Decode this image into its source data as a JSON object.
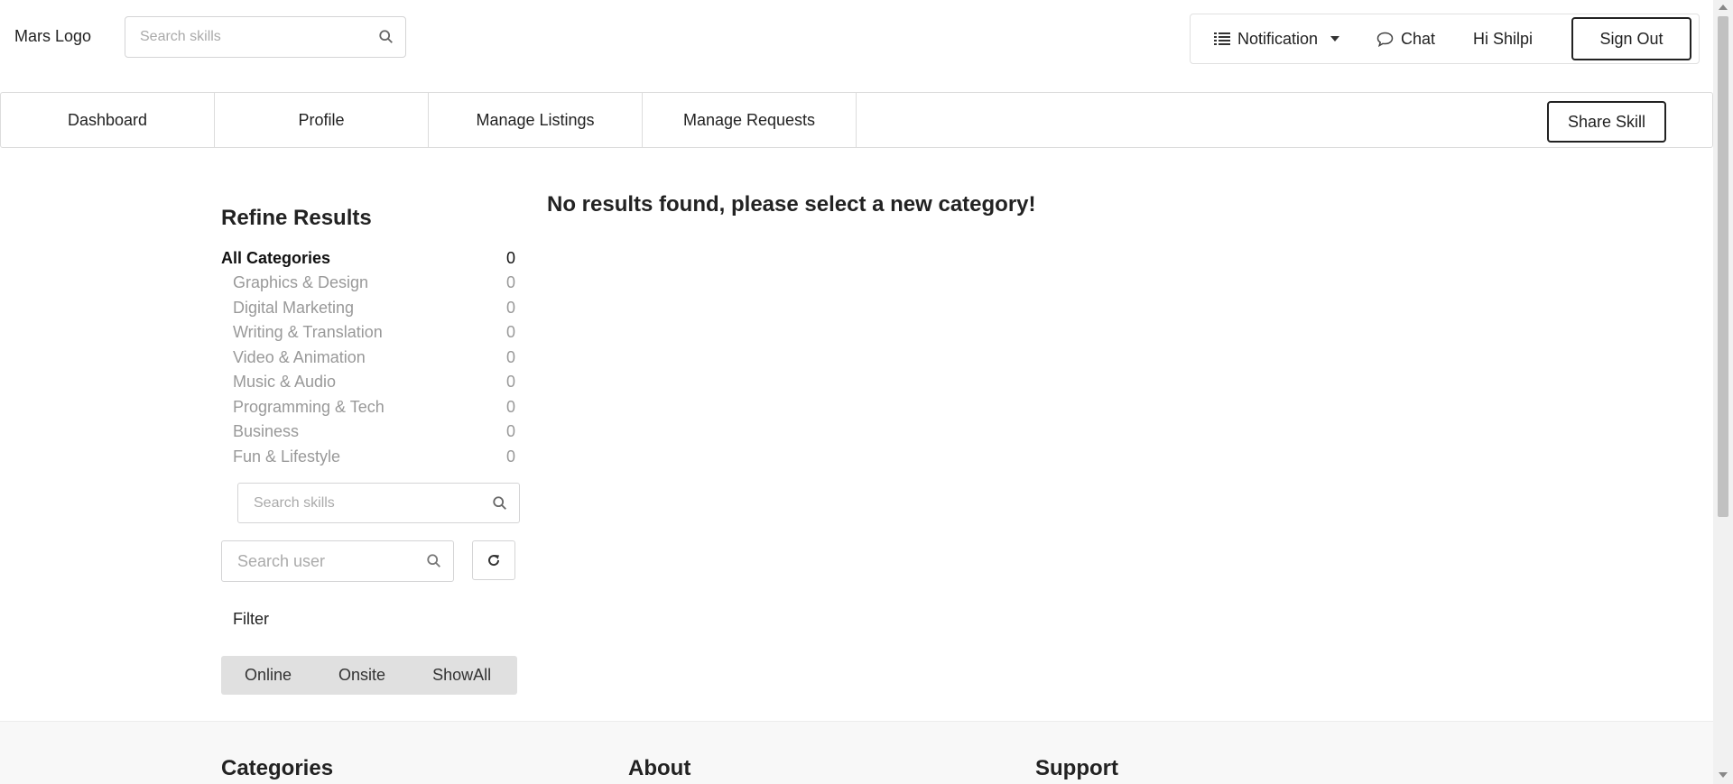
{
  "header": {
    "logo": "Mars Logo",
    "search_placeholder": "Search skills",
    "notification_label": "Notification",
    "chat_label": "Chat",
    "greeting": "Hi Shilpi",
    "signout_label": "Sign Out"
  },
  "nav": {
    "tabs": [
      {
        "label": "Dashboard"
      },
      {
        "label": "Profile"
      },
      {
        "label": "Manage Listings"
      },
      {
        "label": "Manage Requests"
      }
    ],
    "share_label": "Share Skill"
  },
  "sidebar": {
    "title": "Refine Results",
    "all": {
      "label": "All Categories",
      "count": "0"
    },
    "categories": [
      {
        "label": "Graphics & Design",
        "count": "0"
      },
      {
        "label": "Digital Marketing",
        "count": "0"
      },
      {
        "label": "Writing & Translation",
        "count": "0"
      },
      {
        "label": "Video & Animation",
        "count": "0"
      },
      {
        "label": "Music & Audio",
        "count": "0"
      },
      {
        "label": "Programming & Tech",
        "count": "0"
      },
      {
        "label": "Business",
        "count": "0"
      },
      {
        "label": "Fun & Lifestyle",
        "count": "0"
      }
    ],
    "skill_search_placeholder": "Search skills",
    "user_search_placeholder": "Search user",
    "filter_label": "Filter",
    "filters": [
      {
        "label": "Online"
      },
      {
        "label": "Onsite"
      },
      {
        "label": "ShowAll"
      }
    ]
  },
  "main": {
    "message": "No results found, please select a new category!"
  },
  "footer": {
    "headings": [
      {
        "label": "Categories"
      },
      {
        "label": "About"
      },
      {
        "label": "Support"
      }
    ]
  },
  "icons": {
    "search": "search-icon",
    "list": "list-icon",
    "chat": "chat-bubble-icon",
    "refresh": "refresh-icon"
  }
}
